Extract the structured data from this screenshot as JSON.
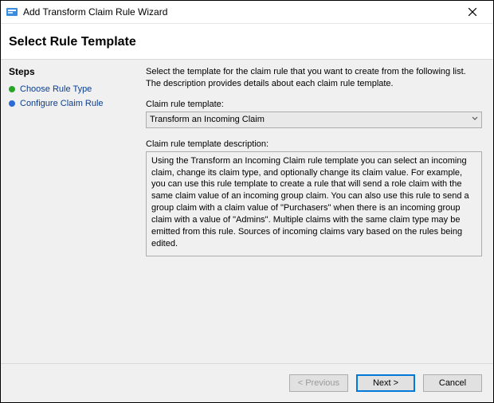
{
  "titlebar": {
    "title": "Add Transform Claim Rule Wizard"
  },
  "header": "Select Rule Template",
  "steps": {
    "heading": "Steps",
    "items": [
      {
        "label": "Choose Rule Type",
        "state": "active"
      },
      {
        "label": "Configure Claim Rule",
        "state": "pending"
      }
    ]
  },
  "content": {
    "intro": "Select the template for the claim rule that you want to create from the following list. The description provides details about each claim rule template.",
    "template_label": "Claim rule template:",
    "template_value": "Transform an Incoming Claim",
    "description_label": "Claim rule template description:",
    "description_text": "Using the Transform an Incoming Claim rule template you can select an incoming claim, change its claim type, and optionally change its claim value.  For example, you can use this rule template to create a rule that will send a role claim with the same claim value of an incoming group claim.  You can also use this rule to send a group claim with a claim value of \"Purchasers\" when there is an incoming group claim with a value of \"Admins\".  Multiple claims with the same claim type may be emitted from this rule.  Sources of incoming claims vary based on the rules being edited."
  },
  "footer": {
    "previous": "< Previous",
    "next": "Next >",
    "cancel": "Cancel"
  }
}
